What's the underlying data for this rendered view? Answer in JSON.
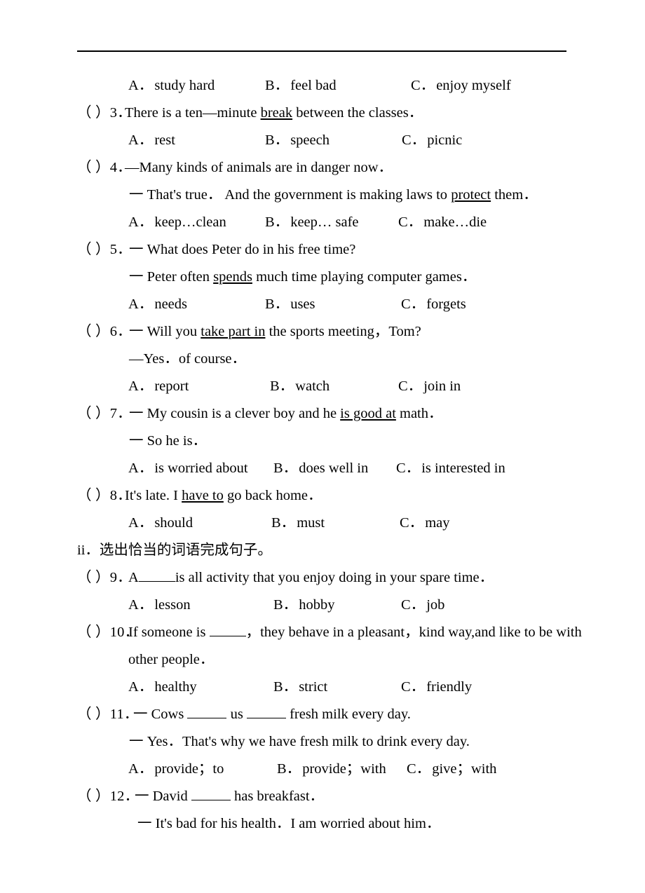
{
  "document": {
    "type": "english-exam-worksheet",
    "section_heading": "ii．选出恰当的词语完成句子。",
    "rule_visible": true
  },
  "questions": [
    {
      "id": "q2-options-only",
      "marker": "",
      "number": "",
      "stem": "",
      "options": [
        {
          "label": "A．",
          "text": "study hard"
        },
        {
          "label": "B．",
          "text": "feel bad"
        },
        {
          "label": "C．",
          "text": "enjoy myself"
        }
      ]
    },
    {
      "id": "q3",
      "marker": "（   ）",
      "number": "3．",
      "stem_pre": "There is a ten—minute ",
      "stem_underline": "break",
      "stem_post": " between the classes．",
      "options": [
        {
          "label": "A．",
          "text": "rest"
        },
        {
          "label": "B．",
          "text": "speech"
        },
        {
          "label": "C．",
          "text": "picnic"
        }
      ]
    },
    {
      "id": "q4",
      "marker": "（   ）",
      "number": "4．",
      "stem": "—Many kinds of animals are in danger now．",
      "reply_pre": "一 That's true．  And the government is making laws to ",
      "reply_underline": "protect",
      "reply_post": " them．",
      "options": [
        {
          "label": "A．",
          "text": "keep…clean"
        },
        {
          "label": "B．",
          "text": "keep… safe"
        },
        {
          "label": "C．",
          "text": "make…die"
        }
      ]
    },
    {
      "id": "q5",
      "marker": "（   ）",
      "number": "5．",
      "stem": "一 What does Peter do in his free time?",
      "reply_pre": "一 Peter often ",
      "reply_underline": "spends",
      "reply_post": " much time playing computer games．",
      "options": [
        {
          "label": "A．",
          "text": "needs"
        },
        {
          "label": "B．",
          "text": "uses"
        },
        {
          "label": "C．",
          "text": "forgets"
        }
      ]
    },
    {
      "id": "q6",
      "marker": "（   ）",
      "number": "6．",
      "stem_pre": "一 Will you ",
      "stem_underline": "take part in",
      "stem_post": " the sports meeting，Tom?",
      "reply": "—Yes．of course．",
      "options": [
        {
          "label": "A．",
          "text": "report"
        },
        {
          "label": "B．",
          "text": "watch"
        },
        {
          "label": "C．",
          "text": "join in"
        }
      ]
    },
    {
      "id": "q7",
      "marker": "（   ）",
      "number": "7．",
      "stem_pre": "一 My cousin is a clever boy and he ",
      "stem_underline": "is good at",
      "stem_post": " math．",
      "reply": "一 So he is．",
      "options": [
        {
          "label": "A．",
          "text": "is worried about"
        },
        {
          "label": "B．",
          "text": "does well in"
        },
        {
          "label": "C．",
          "text": "is interested in"
        }
      ]
    },
    {
      "id": "q8",
      "marker": "（   ）",
      "number": "8．",
      "stem_pre": "It's late. I ",
      "stem_underline": "have to",
      "stem_post": " go back home．",
      "options": [
        {
          "label": "A．",
          "text": "should"
        },
        {
          "label": "B．",
          "text": "must"
        },
        {
          "label": "C．",
          "text": "may"
        }
      ]
    },
    {
      "id": "q9",
      "marker": "（   ）",
      "number": "9．",
      "stem_pre": "A",
      "stem_post": "is all activity that you enjoy doing in your spare time．",
      "options": [
        {
          "label": "A．",
          "text": "lesson"
        },
        {
          "label": "B．",
          "text": "hobby"
        },
        {
          "label": "C．",
          "text": "job"
        }
      ]
    },
    {
      "id": "q10",
      "marker": "（   ）",
      "number": "10．",
      "stem_pre": "If someone is ",
      "stem_post": "，they behave in a pleasant，kind way,and like to be with",
      "stem_line2": "other people．",
      "options": [
        {
          "label": "A．",
          "text": "healthy"
        },
        {
          "label": "B．",
          "text": "strict"
        },
        {
          "label": "C．",
          "text": "friendly"
        }
      ]
    },
    {
      "id": "q11",
      "marker": "（   ）",
      "number": "11．",
      "stem_pre": "一 Cows ",
      "stem_mid": " us ",
      "stem_post": " fresh milk every day.",
      "reply": "一 Yes．That's why we have fresh milk to drink every day.",
      "options": [
        {
          "label": "A．",
          "text": "provide；to"
        },
        {
          "label": "B．",
          "text": "provide；with"
        },
        {
          "label": "C．",
          "text": "give；with"
        }
      ]
    },
    {
      "id": "q12",
      "marker": "（   ）",
      "number": "12．",
      "stem_pre": "一 David ",
      "stem_post": " has breakfast．",
      "reply": "一 It's bad for his health．I am worried about him．"
    }
  ]
}
